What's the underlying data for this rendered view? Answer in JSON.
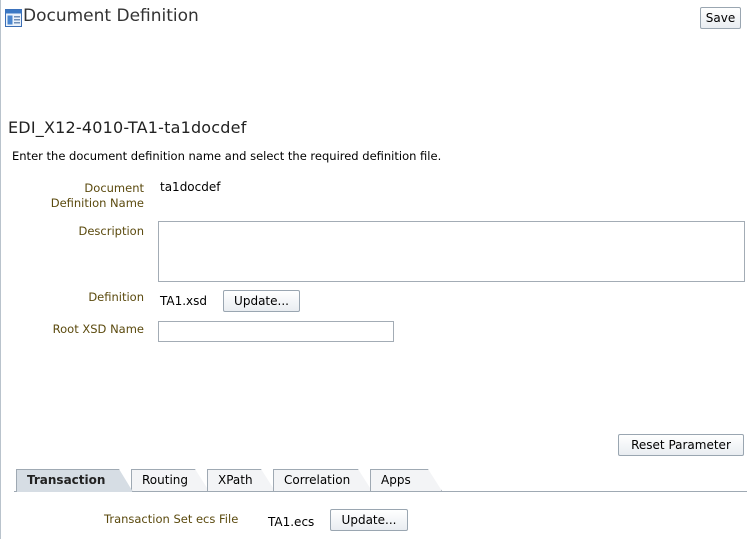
{
  "header": {
    "title": "Document Definition",
    "icon": "document-definition-icon",
    "save_label": "Save"
  },
  "section": {
    "title": "EDI_X12-4010-TA1-ta1docdef",
    "instructions": "Enter the document definition name and select the required definition file."
  },
  "form": {
    "doc_def_name_label_line1": "Document",
    "doc_def_name_label_line2": "Definition Name",
    "doc_def_name_value": "ta1docdef",
    "description_label": "Description",
    "description_value": "",
    "definition_label": "Definition",
    "definition_value": "TA1.xsd",
    "definition_update_label": "Update...",
    "root_xsd_label": "Root XSD Name",
    "root_xsd_value": ""
  },
  "reset_label": "Reset Parameter",
  "tabs": [
    {
      "label": "Transaction",
      "active": true
    },
    {
      "label": "Routing",
      "active": false
    },
    {
      "label": "XPath",
      "active": false
    },
    {
      "label": "Correlation",
      "active": false
    },
    {
      "label": "Apps",
      "active": false
    }
  ],
  "transaction": {
    "ecs_label": "Transaction Set ecs File",
    "ecs_value": "TA1.ecs",
    "ecs_update_label": "Update..."
  },
  "colors": {
    "label": "#5b4a0e",
    "active_tab": "#d6dde4",
    "border": "#9fa9b3"
  }
}
